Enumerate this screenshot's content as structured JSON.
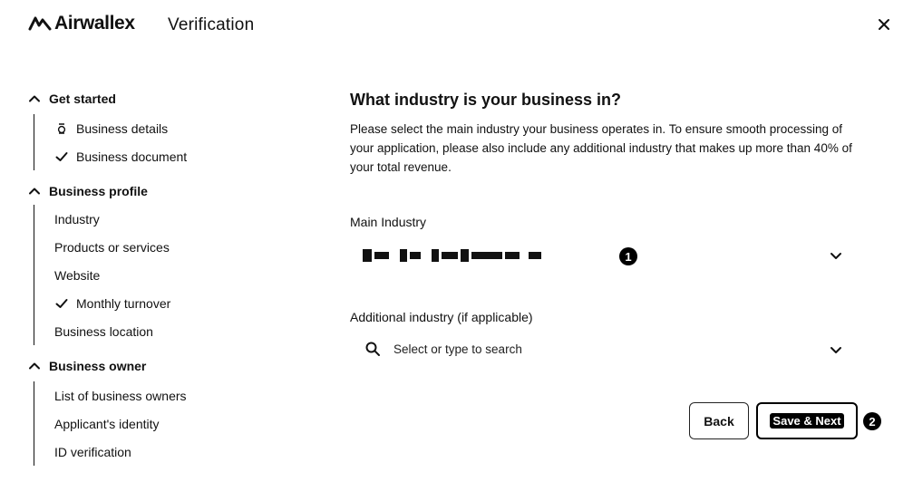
{
  "header": {
    "brand": "Airwallex",
    "title": "Verification",
    "close_icon": "close-icon"
  },
  "sidebar": {
    "sections": [
      {
        "title": "Get started",
        "items": [
          {
            "label": "Business details",
            "icon": "clock-icon"
          },
          {
            "label": "Business document",
            "icon": "check-icon"
          }
        ]
      },
      {
        "title": "Business profile",
        "items": [
          {
            "label": "Industry",
            "icon": ""
          },
          {
            "label": "Products or services",
            "icon": ""
          },
          {
            "label": "Website",
            "icon": ""
          },
          {
            "label": "Monthly turnover",
            "icon": "check-icon"
          },
          {
            "label": "Business location",
            "icon": ""
          }
        ]
      },
      {
        "title": "Business owner",
        "items": [
          {
            "label": "List of business owners",
            "icon": ""
          },
          {
            "label": "Applicant's identity",
            "icon": ""
          },
          {
            "label": "ID verification",
            "icon": ""
          }
        ]
      }
    ]
  },
  "main": {
    "question": "What industry is your business in?",
    "description": "Please select the main industry your business operates in. To ensure smooth processing of your application, please also include any additional industry that makes up more than 40% of your total revenue.",
    "main_industry_label": "Main Industry",
    "main_industry_badge": "1",
    "additional_label": "Additional industry (if applicable)",
    "additional_placeholder": "Select or type to search"
  },
  "actions": {
    "back_label": "Back",
    "next_label": "Save & Next",
    "next_badge": "2"
  }
}
